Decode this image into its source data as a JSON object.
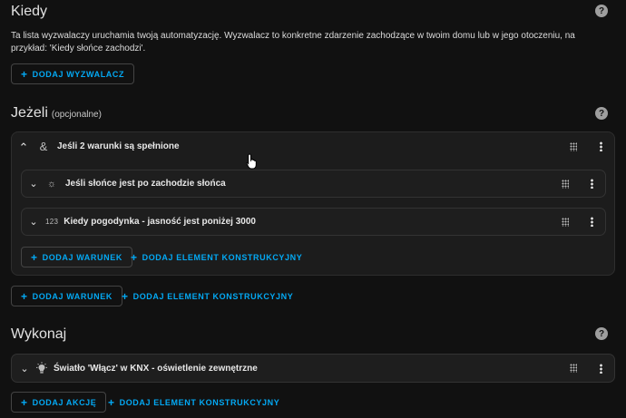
{
  "kiedy": {
    "title": "Kiedy",
    "help_icon": "?",
    "description": "Ta lista wyzwalaczy uruchamia twoją automatyzację. Wyzwalacz to konkretne zdarzenie zachodzące w twoim domu lub w jego otoczeniu, na przykład: 'Kiedy słońce zachodzi'.",
    "add_trigger_label": "DODAJ WYZWALACZ"
  },
  "jezeli": {
    "title": "Jeżeli",
    "optional_label": "(opcjonalne)",
    "help_icon": "?",
    "group": {
      "label": "Jeśli 2 warunki są spełnione",
      "icon": "ampersand-icon",
      "conditions": [
        {
          "label": "Jeśli słońce jest po zachodzie słońca",
          "icon": "sun-icon"
        },
        {
          "label": "Kiedy pogodynka - jasność jest poniżej 3000",
          "icon": "numeric-icon",
          "icon_text": "123"
        }
      ],
      "add_condition_label": "DODAJ WARUNEK",
      "add_building_block_label": "DODAJ ELEMENT KONSTRUKCYJNY"
    },
    "add_condition_label": "DODAJ WARUNEK",
    "add_building_block_label": "DODAJ ELEMENT KONSTRUKCYJNY"
  },
  "wykonaj": {
    "title": "Wykonaj",
    "help_icon": "?",
    "actions": [
      {
        "label": "Światło 'Włącz' w KNX - oświetlenie zewnętrzne",
        "icon": "lightbulb-icon"
      }
    ],
    "add_action_label": "DODAJ AKCJĘ",
    "add_building_block_label": "DODAJ ELEMENT KONSTRUKCYJNY"
  },
  "colors": {
    "background": "#111111",
    "card": "#1c1c1c",
    "accent": "#03a9f4",
    "text": "#e1e1e1"
  },
  "glyphs": {
    "plus": "+",
    "chevron_up": "⌃",
    "chevron_down": "⌄"
  }
}
